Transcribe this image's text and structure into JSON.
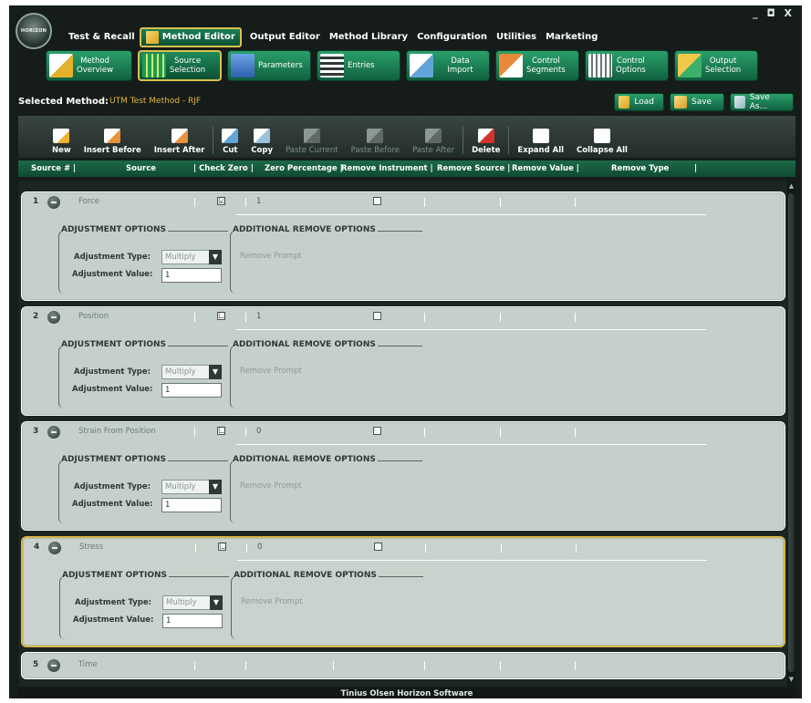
{
  "window": {
    "controls": "_ ◘ X"
  },
  "logo": {
    "text": "HORIZON"
  },
  "menu": [
    {
      "label": "Test & Recall",
      "active": false
    },
    {
      "label": "Method Editor",
      "active": true
    },
    {
      "label": "Output Editor",
      "active": false
    },
    {
      "label": "Method Library",
      "active": false
    },
    {
      "label": "Configuration",
      "active": false
    },
    {
      "label": "Utilities",
      "active": false
    },
    {
      "label": "Marketing",
      "active": false
    }
  ],
  "ribbon": [
    {
      "label": "Method\nOverview",
      "icon": "clipboard-icon",
      "active": false
    },
    {
      "label": "Source\nSelection",
      "icon": "grid-check-icon",
      "active": true
    },
    {
      "label": "Parameters",
      "icon": "form-icon",
      "active": false
    },
    {
      "label": "Entries",
      "icon": "list-icon",
      "active": false
    },
    {
      "label": "Data Import",
      "icon": "import-icon",
      "active": false
    },
    {
      "label": "Control\nSegments",
      "icon": "segments-icon",
      "active": false
    },
    {
      "label": "Control\nOptions",
      "icon": "options-icon",
      "active": false
    },
    {
      "label": "Output\nSelection",
      "icon": "output-check-icon",
      "active": false
    }
  ],
  "selected": {
    "label": "Selected Method:",
    "value": "UTM Test Method - RJF"
  },
  "actions": {
    "load": "Load",
    "save": "Save",
    "save_as": "Save As..."
  },
  "toolbar": {
    "new": "New",
    "insert_before": "Insert Before",
    "insert_after": "Insert After",
    "cut": "Cut",
    "copy": "Copy",
    "paste_current": "Paste Current",
    "paste_before": "Paste Before",
    "paste_after": "Paste After",
    "delete": "Delete",
    "expand_all": "Expand All",
    "collapse_all": "Collapse All"
  },
  "columns": {
    "source_num": "Source # |",
    "source": "Source",
    "check_zero": "| Check Zero |",
    "zero_percentage": "Zero Percentage |",
    "remove_instrument": "Remove Instrument |",
    "remove_source": "Remove Source |",
    "remove_value": "Remove Value |",
    "remove_type": "Remove Type",
    "end": "|"
  },
  "labels": {
    "adjustment_options": "ADJUSTMENT OPTIONS",
    "additional_remove_options": "ADDITIONAL REMOVE OPTIONS",
    "adjustment_type": "Adjustment Type:",
    "adjustment_value": "Adjustment Value:",
    "remove_prompt": "Remove Prompt"
  },
  "rows": [
    {
      "num": "1",
      "name": "Force",
      "check_zero": "☑",
      "zero_percentage": "1",
      "remove_instrument": "☐",
      "adjustment_type": "Multiply",
      "adjustment_value": "1"
    },
    {
      "num": "2",
      "name": "Position",
      "check_zero": "☐",
      "zero_percentage": "1",
      "remove_instrument": "☐",
      "adjustment_type": "Multiply",
      "adjustment_value": "1"
    },
    {
      "num": "3",
      "name": "Strain From Position",
      "check_zero": "☐",
      "zero_percentage": "0",
      "remove_instrument": "☐",
      "adjustment_type": "Multiply",
      "adjustment_value": "1"
    },
    {
      "num": "4",
      "name": "Stress",
      "check_zero": "☐",
      "zero_percentage": "0",
      "remove_instrument": "☐",
      "adjustment_type": "Multiply",
      "adjustment_value": "1"
    },
    {
      "num": "5",
      "name": "Time"
    }
  ],
  "status": "Tinius Olsen Horizon Software",
  "colors": {
    "accent": "#1b7f55",
    "highlight": "#d8b54a",
    "selected_value": "#e8b53a"
  }
}
